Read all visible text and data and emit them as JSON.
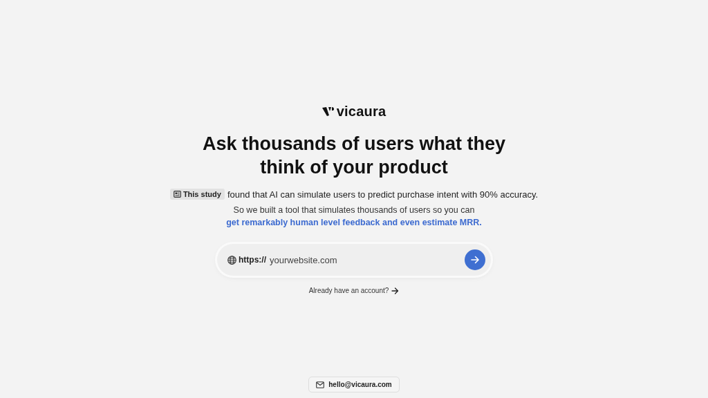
{
  "logo": {
    "text": "vicaura"
  },
  "headline": "Ask thousands of users what they think of your product",
  "study": {
    "badge": "This study",
    "text": "found that AI can simulate users to predict purchase intent with 90% accuracy."
  },
  "pitch": {
    "text": "So we built a tool that simulates thousands of users so you can",
    "link": "get remarkably human level feedback and even estimate MRR."
  },
  "url_field": {
    "prefix": "https://",
    "placeholder": "yourwebsite.com"
  },
  "login_link": "Already have an account?",
  "contact": {
    "email": "hello@vicaura.com"
  }
}
